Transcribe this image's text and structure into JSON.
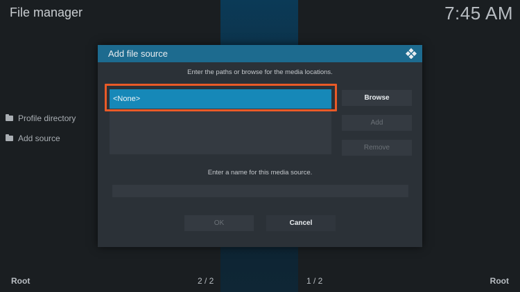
{
  "app": {
    "title": "File manager",
    "clock": "7:45 AM"
  },
  "sidebar": {
    "items": [
      {
        "label": "Profile directory",
        "icon": "folder-icon"
      },
      {
        "label": "Add source",
        "icon": "folder-icon"
      }
    ]
  },
  "footer": {
    "left": "Root",
    "center_left": "2 / 2",
    "center_right": "1 / 2",
    "right": "Root"
  },
  "dialog": {
    "title": "Add file source",
    "instruction_paths": "Enter the paths or browse for the media locations.",
    "path_value": "<None>",
    "browse_label": "Browse",
    "add_label": "Add",
    "remove_label": "Remove",
    "instruction_name": "Enter a name for this media source.",
    "name_value": "",
    "ok_label": "OK",
    "cancel_label": "Cancel",
    "header_color": "#1d6b8f",
    "selection_color": "#1688b8",
    "highlight_color": "#ea5a27"
  }
}
